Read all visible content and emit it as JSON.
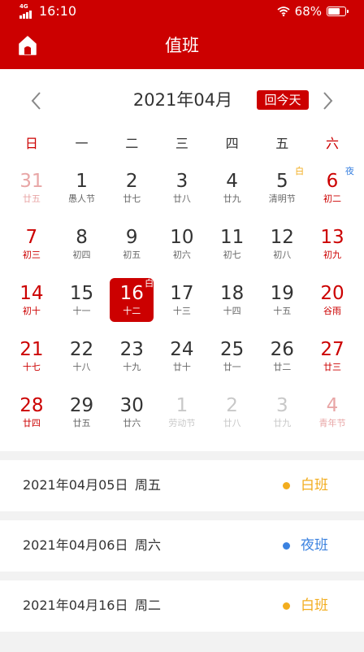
{
  "status_bar": {
    "network": "4G",
    "time": "16:10",
    "battery": "68%",
    "battery_level": 0.68
  },
  "header": {
    "title": "值班"
  },
  "calendar": {
    "month": "2021年04月",
    "today_button": "回今天",
    "weekdays": [
      "日",
      "一",
      "二",
      "三",
      "四",
      "五",
      "六"
    ],
    "weeks": [
      [
        {
          "day": "31",
          "sub": "廿五",
          "other": true
        },
        {
          "day": "1",
          "sub": "愚人节"
        },
        {
          "day": "2",
          "sub": "廿七"
        },
        {
          "day": "3",
          "sub": "廿八"
        },
        {
          "day": "4",
          "sub": "廿九"
        },
        {
          "day": "5",
          "sub": "清明节",
          "tag": "白",
          "tag_type": "day"
        },
        {
          "day": "6",
          "sub": "初二",
          "tag": "夜",
          "tag_type": "night"
        }
      ],
      [
        {
          "day": "7",
          "sub": "初三"
        },
        {
          "day": "8",
          "sub": "初四"
        },
        {
          "day": "9",
          "sub": "初五"
        },
        {
          "day": "10",
          "sub": "初六"
        },
        {
          "day": "11",
          "sub": "初七"
        },
        {
          "day": "12",
          "sub": "初八"
        },
        {
          "day": "13",
          "sub": "初九"
        }
      ],
      [
        {
          "day": "14",
          "sub": "初十"
        },
        {
          "day": "15",
          "sub": "十一"
        },
        {
          "day": "16",
          "sub": "十二",
          "tag": "白",
          "tag_type": "day",
          "selected": true
        },
        {
          "day": "17",
          "sub": "十三"
        },
        {
          "day": "18",
          "sub": "十四"
        },
        {
          "day": "19",
          "sub": "十五"
        },
        {
          "day": "20",
          "sub": "谷雨"
        }
      ],
      [
        {
          "day": "21",
          "sub": "十七"
        },
        {
          "day": "22",
          "sub": "十八"
        },
        {
          "day": "23",
          "sub": "十九"
        },
        {
          "day": "24",
          "sub": "廿十"
        },
        {
          "day": "25",
          "sub": "廿一"
        },
        {
          "day": "26",
          "sub": "廿二"
        },
        {
          "day": "27",
          "sub": "廿三"
        }
      ],
      [
        {
          "day": "28",
          "sub": "廿四"
        },
        {
          "day": "29",
          "sub": "廿五"
        },
        {
          "day": "30",
          "sub": "廿六"
        },
        {
          "day": "1",
          "sub": "劳动节",
          "other": true
        },
        {
          "day": "2",
          "sub": "廿八",
          "other": true
        },
        {
          "day": "3",
          "sub": "廿九",
          "other": true
        },
        {
          "day": "4",
          "sub": "青年节",
          "other": true
        }
      ]
    ]
  },
  "shifts": [
    {
      "date": "2021年04月05日",
      "weekday": "周五",
      "type": "白班",
      "color": "#f2ad1f"
    },
    {
      "date": "2021年04月06日",
      "weekday": "周六",
      "type": "夜班",
      "color": "#3b82e0"
    },
    {
      "date": "2021年04月16日",
      "weekday": "周二",
      "type": "白班",
      "color": "#f2ad1f"
    }
  ],
  "colors": {
    "brand": "#cc0000",
    "day_shift": "#f2ad1f",
    "night_shift": "#3b82e0"
  },
  "icons": {
    "home": "home-icon",
    "prev": "chevron-left-icon",
    "next": "chevron-right-icon",
    "wifi": "wifi-icon",
    "signal": "signal-icon",
    "battery": "battery-icon"
  }
}
